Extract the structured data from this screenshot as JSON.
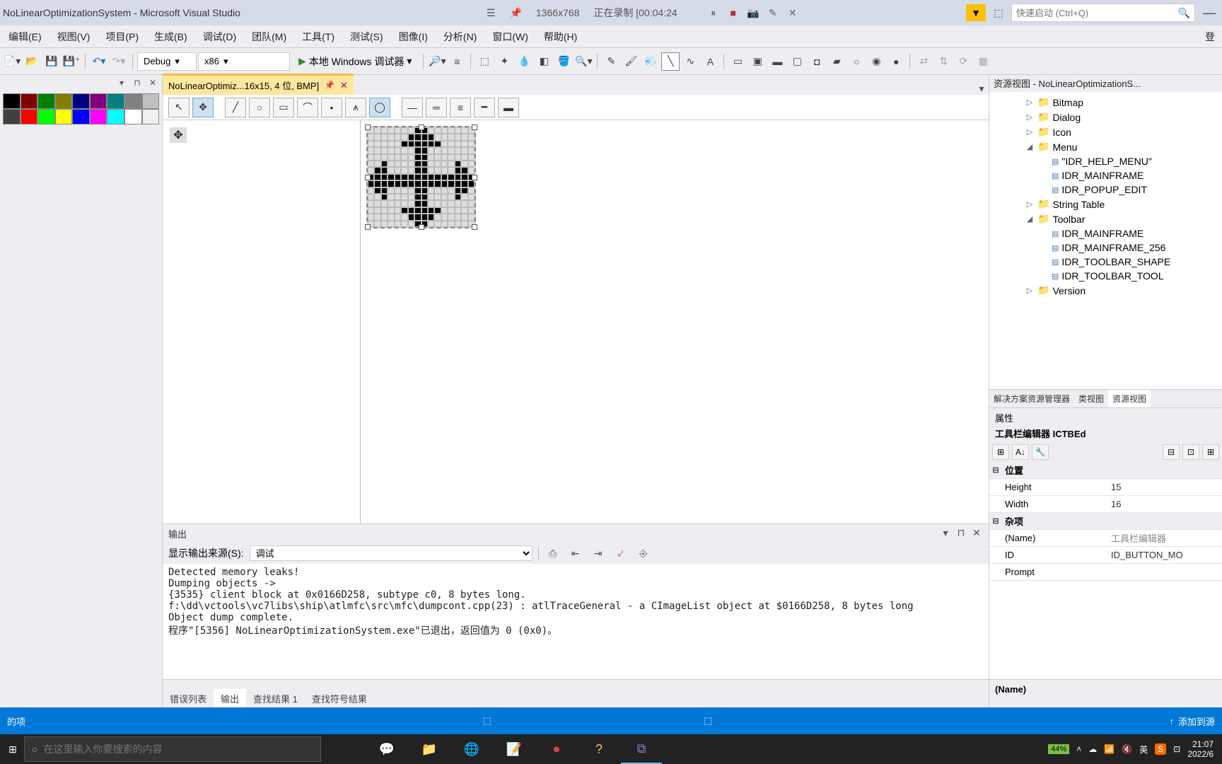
{
  "titlebar": {
    "app_title": "NoLinearOptimizationSystem - Microsoft Visual Studio",
    "resolution": "1366x768",
    "recording": "正在录制 [00:04:24",
    "quick_launch_placeholder": "快速启动 (Ctrl+Q)"
  },
  "menubar": {
    "items": [
      "编辑(E)",
      "视图(V)",
      "项目(P)",
      "生成(B)",
      "调试(D)",
      "团队(M)",
      "工具(T)",
      "测试(S)",
      "图像(I)",
      "分析(N)",
      "窗口(W)",
      "帮助(H)"
    ],
    "login": "登"
  },
  "toolbar": {
    "config": "Debug",
    "platform": "x86",
    "run_label": "本地 Windows 调试器"
  },
  "tab": {
    "label": "NoLinearOptimiz...16x15, 4 位, BMP]"
  },
  "palette": {
    "row1": [
      "#000000",
      "#800000",
      "#008000",
      "#808000",
      "#000080",
      "#800080",
      "#008080",
      "#808080",
      "#c0c0c0"
    ],
    "row2": [
      "#404040",
      "#ff0000",
      "#00ff00",
      "#ffff00",
      "#0000ff",
      "#ff00ff",
      "#00ffff",
      "#ffffff",
      "#f0f0f0"
    ]
  },
  "bitmap": {
    "rows": [
      "0000000110000000",
      "0000001111000000",
      "0000011111100000",
      "0000000110000000",
      "0000000110000000",
      "0010000110000100",
      "0110000110000110",
      "1111111111111111",
      "1111111111111111",
      "0110000110000110",
      "0010000110000100",
      "0000000110000000",
      "0000011111100000",
      "0000001111000000",
      "0000000110000000"
    ]
  },
  "resource_view": {
    "title": "资源视图 - NoLinearOptimizationS...",
    "nodes": [
      {
        "level": 1,
        "exp": "▷",
        "icon": "folder",
        "label": "Bitmap"
      },
      {
        "level": 1,
        "exp": "▷",
        "icon": "folder",
        "label": "Dialog"
      },
      {
        "level": 1,
        "exp": "▷",
        "icon": "folder",
        "label": "Icon"
      },
      {
        "level": 1,
        "exp": "◢",
        "icon": "folder",
        "label": "Menu"
      },
      {
        "level": 2,
        "exp": "",
        "icon": "doc",
        "label": "\"IDR_HELP_MENU\""
      },
      {
        "level": 2,
        "exp": "",
        "icon": "doc",
        "label": "IDR_MAINFRAME"
      },
      {
        "level": 2,
        "exp": "",
        "icon": "doc",
        "label": "IDR_POPUP_EDIT"
      },
      {
        "level": 1,
        "exp": "▷",
        "icon": "folder",
        "label": "String Table"
      },
      {
        "level": 1,
        "exp": "◢",
        "icon": "folder",
        "label": "Toolbar"
      },
      {
        "level": 2,
        "exp": "",
        "icon": "doc",
        "label": "IDR_MAINFRAME"
      },
      {
        "level": 2,
        "exp": "",
        "icon": "doc",
        "label": "IDR_MAINFRAME_256"
      },
      {
        "level": 2,
        "exp": "",
        "icon": "doc",
        "label": "IDR_TOOLBAR_SHAPE"
      },
      {
        "level": 2,
        "exp": "",
        "icon": "doc",
        "label": "IDR_TOOLBAR_TOOL"
      },
      {
        "level": 1,
        "exp": "▷",
        "icon": "folder",
        "label": "Version"
      }
    ],
    "tabs": [
      "解决方案资源管理器",
      "类视图",
      "资源视图"
    ]
  },
  "properties": {
    "title": "属性",
    "subtitle": "工具栏编辑器 ICTBEd",
    "cat1": "位置",
    "height_label": "Height",
    "height_val": "15",
    "width_label": "Width",
    "width_val": "16",
    "cat2": "杂项",
    "name_label": "(Name)",
    "name_val": "工具栏编辑器",
    "id_label": "ID",
    "id_val": "ID_BUTTON_MO",
    "prompt_label": "Prompt",
    "desc": "(Name)"
  },
  "output": {
    "title": "输出",
    "filter_label": "显示输出来源(S):",
    "filter_value": "调试",
    "lines": [
      "Detected memory leaks!",
      "Dumping objects ->",
      "{3535} client block at 0x0166D258, subtype c0, 8 bytes long.",
      "f:\\dd\\vctools\\vc7libs\\ship\\atlmfc\\src\\mfc\\dumpcont.cpp(23) : atlTraceGeneral - a CImageList object at $0166D258, 8 bytes long",
      "Object dump complete.",
      "程序\"[5356] NoLinearOptimizationSystem.exe\"已退出，返回值为 0 (0x0)。"
    ],
    "tabs": [
      "错误列表",
      "输出",
      "查找结果 1",
      "查找符号结果"
    ]
  },
  "statusbar": {
    "left": "的项",
    "right": "添加到源"
  },
  "taskbar": {
    "search_placeholder": "在这里输入你要搜索的内容",
    "battery": "44%",
    "ime": "英",
    "time": "21:07",
    "date": "2022/6"
  }
}
